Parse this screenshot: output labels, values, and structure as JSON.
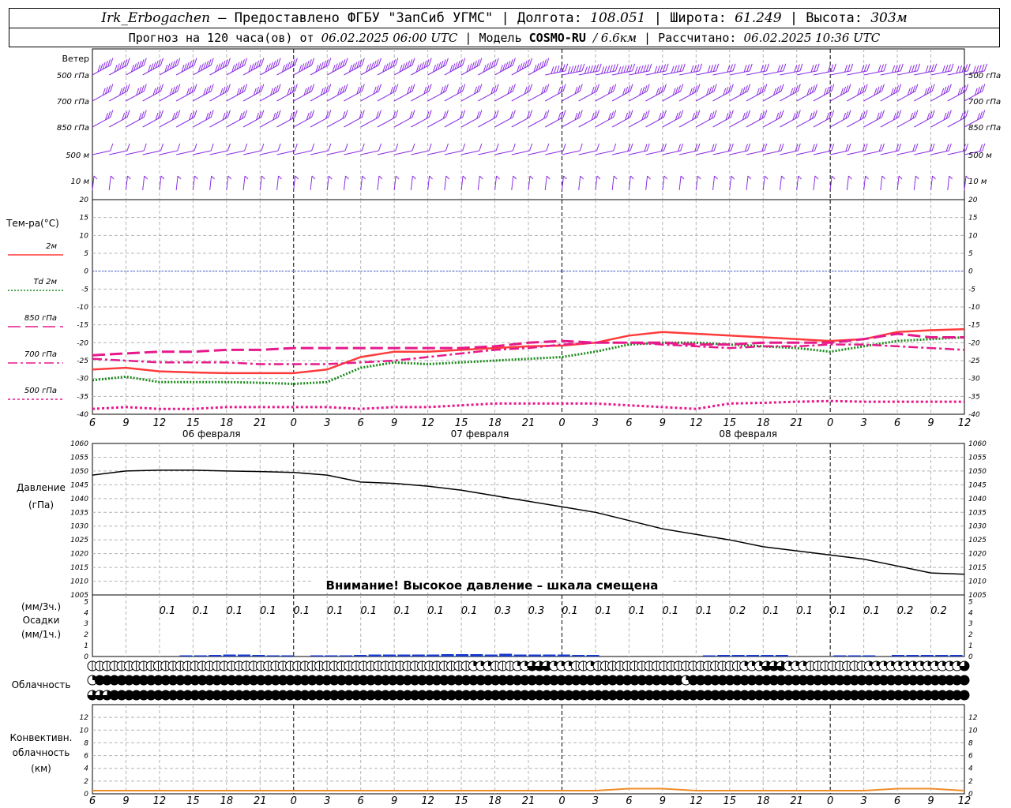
{
  "header": {
    "line1": {
      "station": "Irk_Erbogachen",
      "provider": "– Предоставлено ФГБУ \"ЗапСиб УГМС\"",
      "lon_label": "Долгота:",
      "lon_value": "108.051",
      "lat_label": "Широта:",
      "lat_value": "61.249",
      "alt_label": "Высота:",
      "alt_value": "303м"
    },
    "line2": {
      "forecast_label": "Прогноз на 120 часа(ов) от",
      "forecast_start": "06.02.2025 06:00 UTC",
      "model_label": "Модель",
      "model_name": "COSMO-RU",
      "model_res": "/ 6.6км",
      "calc_label": "Рассчитано:",
      "calc_time": "06.02.2025 10:36 UTC"
    }
  },
  "colors": {
    "grid": "#b4b4b4",
    "wind": "#8a2be2",
    "t2m": "#ff3b3b",
    "td2m": "#1a8a1a",
    "t850": "#e6198c",
    "t700": "#e6198c",
    "t500": "#e6198c",
    "zero_line": "#3b5bdb",
    "pressure": "#000000",
    "precip": "#1a3ccc",
    "convective": "#f08c28"
  },
  "panels": {
    "wind": {
      "title": "Ветер",
      "levels": [
        "500 гПа",
        "700 гПа",
        "850 гПа",
        "500 м",
        "10  м"
      ]
    },
    "temperature": {
      "title": "Тем-ра(°C)",
      "legend": [
        {
          "key": "t2m",
          "label": "2м"
        },
        {
          "key": "td2m",
          "label": "Td  2м"
        },
        {
          "key": "t850",
          "label": "850 гПа"
        },
        {
          "key": "t700",
          "label": "700 гПа"
        },
        {
          "key": "t500",
          "label": "500 гПа"
        }
      ]
    },
    "pressure": {
      "title": "Давление",
      "unit": "(гПа)",
      "warning": "Внимание! Высокое давление – шкала смещена"
    },
    "precip": {
      "unit3h": "(мм/3ч.)",
      "title": "Осадки",
      "unit1h": "(мм/1ч.)"
    },
    "cloud": {
      "title": "Облачность"
    },
    "convective": {
      "title1": "Конвективн.",
      "title2": "облачность",
      "unit": "(км)"
    }
  },
  "dates": [
    "06 февраля",
    "07 февраля",
    "08 февраля"
  ],
  "chart_data": [
    {
      "type": "line",
      "panel": "temperature",
      "ylim": [
        -40,
        20
      ],
      "yticks": [
        -40,
        -35,
        -30,
        -25,
        -20,
        -15,
        -10,
        -5,
        0,
        5,
        10,
        15,
        20
      ],
      "x_hours": [
        0,
        3,
        6,
        9,
        12,
        15,
        18,
        21,
        24,
        27,
        30,
        33,
        36,
        39,
        42,
        45,
        48,
        51,
        54,
        57,
        60,
        63,
        66,
        69,
        72,
        75,
        78
      ],
      "x_labels": [
        "6",
        "9",
        "12",
        "15",
        "18",
        "21",
        "0",
        "3",
        "6",
        "9",
        "12",
        "15",
        "18",
        "21",
        "0",
        "3",
        "6",
        "9",
        "12",
        "15",
        "18",
        "21",
        "0",
        "3",
        "6",
        "9",
        "12"
      ],
      "series": [
        {
          "name": "2м",
          "key": "t2m",
          "values": [
            -27.5,
            -27,
            -28,
            -28.3,
            -28.5,
            -28.5,
            -28.5,
            -27.5,
            -24,
            -22.5,
            -22.5,
            -22,
            -21.5,
            -21,
            -20.8,
            -20,
            -18,
            -17,
            -17.5,
            -18,
            -18.5,
            -19,
            -19.5,
            -19,
            -17,
            -16.5,
            -16.2
          ]
        },
        {
          "name": "Td  2м",
          "key": "td2m",
          "values": [
            -30.5,
            -29.5,
            -31,
            -31,
            -31,
            -31.2,
            -31.5,
            -31,
            -27,
            -25.5,
            -26,
            -25.5,
            -25,
            -24.5,
            -24,
            -22.5,
            -20.5,
            -20,
            -20,
            -20.5,
            -21,
            -21.5,
            -22.5,
            -21,
            -19.5,
            -19,
            -18.5
          ]
        },
        {
          "name": "850 гПа",
          "key": "t850",
          "values": [
            -23.5,
            -23,
            -22.5,
            -22.5,
            -22,
            -22,
            -21.5,
            -21.5,
            -21.5,
            -21.5,
            -21.5,
            -21.5,
            -21,
            -20,
            -19.5,
            -20,
            -20,
            -20,
            -20.5,
            -20.5,
            -20,
            -20,
            -20,
            -19,
            -17.5,
            -18.5,
            -18.5
          ]
        },
        {
          "name": "700 гПа",
          "key": "t700",
          "values": [
            -24.5,
            -25,
            -25.5,
            -25.5,
            -25.5,
            -26,
            -26,
            -26,
            -25.5,
            -25,
            -24,
            -23,
            -22,
            -21.5,
            -20.5,
            -20,
            -20,
            -20.5,
            -21,
            -21.5,
            -21,
            -21,
            -20.5,
            -20.5,
            -21,
            -21.5,
            -22
          ]
        },
        {
          "name": "500 гПа",
          "key": "t500",
          "values": [
            -38.5,
            -38,
            -38.5,
            -38.5,
            -38,
            -38,
            -38,
            -38,
            -38.5,
            -38,
            -38,
            -37.5,
            -37,
            -37,
            -37,
            -37,
            -37.5,
            -38,
            -38.5,
            -37,
            -36.8,
            -36.5,
            -36.3,
            -36.5,
            -36.5,
            -36.5,
            -36.5
          ]
        }
      ]
    },
    {
      "type": "line",
      "panel": "pressure",
      "ylim": [
        1005,
        1060
      ],
      "yticks": [
        1005,
        1010,
        1015,
        1020,
        1025,
        1030,
        1035,
        1040,
        1045,
        1050,
        1055,
        1060
      ],
      "x_hours": [
        0,
        3,
        6,
        9,
        12,
        15,
        18,
        21,
        24,
        27,
        30,
        33,
        36,
        39,
        42,
        45,
        48,
        51,
        54,
        57,
        60,
        63,
        66,
        69,
        72,
        75,
        78
      ],
      "series": [
        {
          "name": "Давление",
          "values": [
            1048.5,
            1050,
            1050.3,
            1050.3,
            1050,
            1049.8,
            1049.5,
            1048.5,
            1046,
            1045.5,
            1044.5,
            1043,
            1041,
            1039,
            1037,
            1035,
            1032,
            1029,
            1027,
            1025,
            1022.5,
            1021,
            1019.5,
            1018,
            1015.5,
            1013,
            1012.5
          ]
        }
      ]
    },
    {
      "type": "bar",
      "panel": "precip",
      "ylim": [
        0,
        5
      ],
      "yticks": [
        0,
        1,
        2,
        3,
        4,
        5
      ],
      "labels_3h": [
        "0.1",
        "0.1",
        "0.1",
        "0.1",
        "0.1",
        "0.1",
        "0.1",
        "0.1",
        "0.1",
        "0.1",
        "0.3",
        "0.3",
        "0.1",
        "0.1",
        "0.1",
        "0.1",
        "0.1",
        "0.2",
        "0.1",
        "0.1",
        "0.1",
        "0.1",
        "0.2",
        "0.2"
      ],
      "values_1h": [
        0,
        0,
        0,
        0,
        0,
        0,
        0.05,
        0.05,
        0.1,
        0.15,
        0.15,
        0.1,
        0.05,
        0.05,
        0,
        0.05,
        0.05,
        0.05,
        0.1,
        0.15,
        0.15,
        0.15,
        0.15,
        0.15,
        0.2,
        0.2,
        0.2,
        0.15,
        0.25,
        0.15,
        0.15,
        0.15,
        0.15,
        0.1,
        0.1,
        0,
        0,
        0,
        0,
        0,
        0,
        0,
        0.05,
        0.1,
        0.1,
        0.1,
        0.1,
        0.1,
        0,
        0,
        0,
        0.05,
        0.05,
        0.05,
        0,
        0.1,
        0.1,
        0.1,
        0.1,
        0.1
      ]
    },
    {
      "type": "table",
      "panel": "cloud",
      "rows": [
        {
          "name": "upper",
          "values": [
            1,
            1,
            1,
            1,
            1,
            1,
            1,
            1,
            1,
            1,
            1,
            1,
            1,
            1,
            1,
            1,
            1,
            1,
            1,
            1,
            1,
            1,
            1,
            1,
            1,
            1,
            1,
            1,
            1,
            1,
            1,
            1,
            1,
            1,
            1,
            1,
            1,
            1,
            1,
            1,
            1,
            1,
            1,
            1,
            1,
            1,
            1,
            1,
            1,
            1,
            1,
            1,
            2,
            2,
            2,
            1,
            1,
            1,
            2,
            2,
            3,
            3,
            3,
            2,
            2,
            2,
            1,
            1,
            2,
            1,
            1,
            1,
            1,
            1,
            1,
            1,
            1,
            1,
            1,
            1,
            1,
            1,
            1,
            1,
            1,
            1,
            1,
            1,
            1,
            2,
            2,
            2,
            3,
            3,
            3,
            2,
            2,
            2,
            1,
            1,
            1,
            1,
            1,
            1,
            1,
            1,
            2,
            2,
            2,
            2,
            2,
            2,
            2,
            2,
            2,
            2,
            2,
            2,
            2,
            3
          ]
        },
        {
          "name": "middle",
          "values": [
            2,
            4,
            4,
            4,
            4,
            4,
            4,
            4,
            4,
            4,
            4,
            4,
            4,
            4,
            4,
            4,
            4,
            4,
            4,
            4,
            4,
            4,
            4,
            4,
            4,
            4,
            4,
            4,
            4,
            4,
            4,
            4,
            4,
            4,
            4,
            4,
            4,
            4,
            4,
            4,
            4,
            4,
            4,
            4,
            4,
            4,
            4,
            4,
            4,
            4,
            4,
            4,
            4,
            4,
            4,
            4,
            4,
            4,
            4,
            4,
            4,
            4,
            4,
            4,
            4,
            4,
            4,
            4,
            4,
            4,
            4,
            4,
            4,
            4,
            4,
            4,
            4,
            4,
            4,
            4,
            4,
            2,
            4,
            4,
            4,
            4,
            4,
            4,
            4,
            4,
            4,
            4,
            4,
            4,
            4,
            4,
            4,
            4,
            4,
            4,
            4,
            4,
            4,
            4,
            4,
            4,
            4,
            4,
            4,
            4,
            4,
            4,
            4,
            4,
            4,
            4,
            4,
            4,
            4,
            4
          ]
        },
        {
          "name": "lower",
          "values": [
            3,
            3,
            3,
            4,
            4,
            4,
            4,
            4,
            4,
            4,
            4,
            4,
            4,
            4,
            4,
            4,
            4,
            4,
            4,
            4,
            4,
            4,
            4,
            4,
            4,
            4,
            4,
            4,
            4,
            4,
            4,
            4,
            4,
            4,
            4,
            4,
            4,
            4,
            4,
            4,
            4,
            4,
            4,
            4,
            4,
            4,
            4,
            4,
            4,
            4,
            4,
            4,
            4,
            4,
            4,
            4,
            4,
            4,
            4,
            4,
            4,
            4,
            4,
            4,
            4,
            4,
            4,
            4,
            4,
            4,
            4,
            4,
            4,
            4,
            4,
            4,
            4,
            4,
            4,
            4,
            4,
            4,
            4,
            4,
            4,
            4,
            4,
            4,
            4,
            4,
            4,
            4,
            4,
            4,
            4,
            4,
            4,
            4,
            4,
            4,
            4,
            4,
            4,
            4,
            4,
            4,
            4,
            4,
            4,
            4,
            4,
            4,
            4,
            4,
            4,
            4,
            4,
            4,
            4,
            4
          ]
        }
      ]
    },
    {
      "type": "area",
      "panel": "convective",
      "ylim": [
        0,
        14
      ],
      "yticks": [
        0,
        2,
        4,
        6,
        8,
        10,
        12
      ],
      "x_hours": [
        0,
        3,
        6,
        9,
        12,
        15,
        18,
        21,
        24,
        27,
        30,
        33,
        36,
        39,
        42,
        45,
        48,
        51,
        54,
        57,
        60,
        63,
        66,
        69,
        72,
        75,
        78
      ],
      "values": [
        0.5,
        0.5,
        0.5,
        0.5,
        0.5,
        0.5,
        0.5,
        0.5,
        0.5,
        0.5,
        0.5,
        0.5,
        0.5,
        0.5,
        0.5,
        0.5,
        0.8,
        0.8,
        0.5,
        0.5,
        0.5,
        0.5,
        0.5,
        0.5,
        0.8,
        0.8,
        0.5
      ]
    },
    {
      "type": "scatter",
      "panel": "wind",
      "levels": [
        "500 гПа",
        "700 гПа",
        "850 гПа",
        "500 м",
        "10  м"
      ],
      "speed_ms": [
        [
          35,
          35,
          35,
          35,
          35,
          35,
          35,
          35,
          35,
          35,
          35,
          35,
          35,
          35,
          35,
          35,
          35,
          30,
          25,
          20,
          20,
          20,
          20,
          20,
          22,
          25,
          28
        ],
        [
          25,
          25,
          25,
          25,
          25,
          25,
          25,
          25,
          20,
          20,
          20,
          20,
          20,
          20,
          20,
          20,
          25,
          25,
          25,
          25,
          25,
          25,
          25,
          25,
          25,
          25,
          25
        ],
        [
          15,
          15,
          15,
          15,
          15,
          15,
          15,
          12,
          10,
          10,
          10,
          12,
          12,
          12,
          15,
          15,
          15,
          15,
          18,
          18,
          18,
          18,
          18,
          18,
          20,
          20,
          20
        ],
        [
          8,
          8,
          8,
          8,
          8,
          8,
          8,
          8,
          8,
          8,
          8,
          8,
          8,
          8,
          8,
          8,
          10,
          12,
          12,
          12,
          12,
          12,
          12,
          12,
          12,
          12,
          12
        ],
        [
          3,
          3,
          3,
          3,
          3,
          3,
          3,
          3,
          3,
          3,
          3,
          3,
          3,
          3,
          3,
          3,
          4,
          4,
          4,
          4,
          4,
          4,
          4,
          4,
          4,
          4,
          4
        ]
      ]
    }
  ]
}
